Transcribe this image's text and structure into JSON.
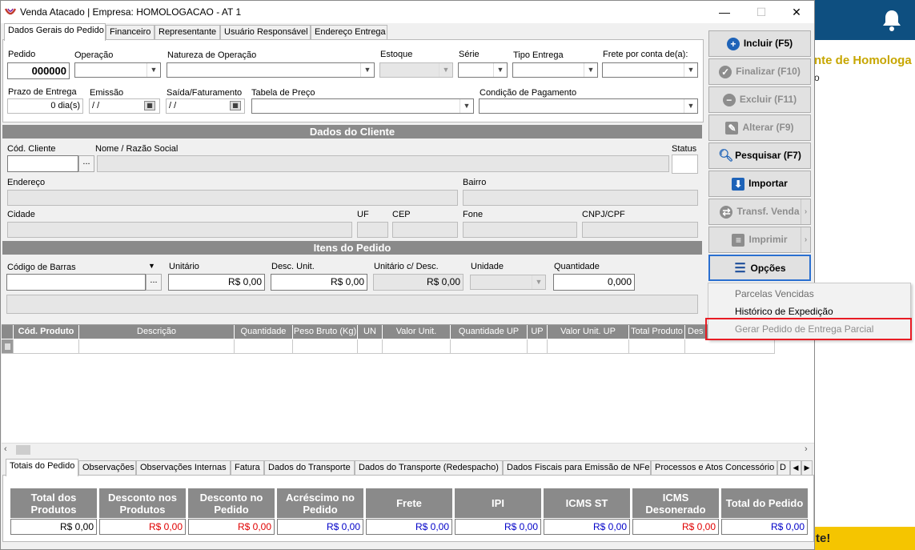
{
  "background_app": {
    "text1": "nte de Homologa",
    "text2": "o",
    "bar_text": "te!"
  },
  "window": {
    "title": "Venda Atacado | Empresa: HOMOLOGACAO - AT 1",
    "minimize": "—",
    "maximize": "☐",
    "close": "✕"
  },
  "top_tabs": [
    "Dados Gerais do Pedido",
    "Financeiro",
    "Representante",
    "Usuário Responsável",
    "Endereço Entrega"
  ],
  "pedido": {
    "labels": {
      "pedido": "Pedido",
      "operacao": "Operação",
      "natureza": "Natureza de Operação",
      "estoque": "Estoque",
      "serie": "Série",
      "tipo_entrega": "Tipo Entrega",
      "frete": "Frete por conta de(a):",
      "prazo": "Prazo de Entrega",
      "emissao": "Emissão",
      "saida": "Saída/Faturamento",
      "tabela": "Tabela de Preço",
      "condicao": "Condição de Pagamento"
    },
    "pedido_value": "000000",
    "prazo_value": "0 dia(s)",
    "emissao_value": " /  /",
    "saida_value": " /  /"
  },
  "cliente": {
    "section_title": "Dados do Cliente",
    "labels": {
      "cod": "Cód. Cliente",
      "nome": "Nome / Razão Social",
      "status": "Status",
      "endereco": "Endereço",
      "bairro": "Bairro",
      "cidade": "Cidade",
      "uf": "UF",
      "cep": "CEP",
      "fone": "Fone",
      "cnpj": "CNPJ/CPF"
    },
    "lookup_button": "..."
  },
  "itens": {
    "section_title": "Itens do Pedido",
    "labels": {
      "codigo_barras": "Código de Barras",
      "unitario": "Unitário",
      "desc_unit": "Desc. Unit.",
      "unit_desc": "Unitário c/ Desc.",
      "unidade": "Unidade",
      "quantidade": "Quantidade"
    },
    "unitario_value": "R$ 0,00",
    "desc_unit_value": "R$ 0,00",
    "unit_desc_value": "R$ 0,00",
    "quantidade_value": "0,000",
    "lookup_button": "..."
  },
  "grid": {
    "columns": [
      "Cód. Produto",
      "Descrição",
      "Quantidade",
      "Peso Bruto (Kg)",
      "UN",
      "Valor Unit.",
      "Quantidade UP",
      "UP",
      "Valor Unit. UP",
      "Total Produto",
      "Des"
    ]
  },
  "bottom_tabs": [
    "Totais do Pedido",
    "Observações",
    "Observações Internas",
    "Fatura",
    "Dados do Transporte",
    "Dados do Transporte (Redespacho)",
    "Dados Fiscais para Emissão de NFe",
    "Processos e Atos Concessório",
    "D"
  ],
  "totals": [
    {
      "label": "Total dos Produtos",
      "value": "R$ 0,00",
      "color": "#000000"
    },
    {
      "label": "Desconto nos Produtos",
      "value": "R$ 0,00",
      "color": "#e00000"
    },
    {
      "label": "Desconto no Pedido",
      "value": "R$ 0,00",
      "color": "#e00000"
    },
    {
      "label": "Acréscimo no Pedido",
      "value": "R$ 0,00",
      "color": "#0000c8"
    },
    {
      "label": "Frete",
      "value": "R$ 0,00",
      "color": "#0000c8"
    },
    {
      "label": "IPI",
      "value": "R$ 0,00",
      "color": "#0000c8"
    },
    {
      "label": "ICMS ST",
      "value": "R$ 0,00",
      "color": "#0000c8"
    },
    {
      "label": "ICMS Desonerado",
      "value": "R$ 0,00",
      "color": "#e00000"
    },
    {
      "label": "Total do Pedido",
      "value": "R$ 0,00",
      "color": "#0000c8"
    }
  ],
  "actions": {
    "incluir": "Incluir (F5)",
    "finalizar": "Finalizar (F10)",
    "excluir": "Excluir (F11)",
    "alterar": "Alterar (F9)",
    "pesquisar": "Pesquisar (F7)",
    "importar": "Importar",
    "transf": "Transf. Venda",
    "imprimir": "Imprimir",
    "opcoes": "Opções"
  },
  "options_menu": [
    "Parcelas Vencidas",
    "Histórico de Expedição",
    "Gerar Pedido de Entrega Parcial"
  ]
}
